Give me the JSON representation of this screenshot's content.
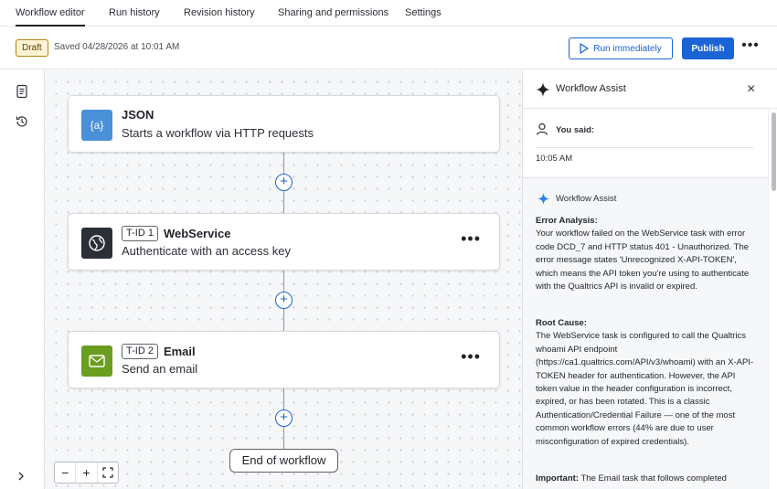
{
  "tabs": [
    {
      "label": "Workflow editor",
      "active": true
    },
    {
      "label": "Run history",
      "active": false
    },
    {
      "label": "Revision history",
      "active": false
    },
    {
      "label": "Sharing and permissions",
      "active": false
    },
    {
      "label": "Settings",
      "active": false
    }
  ],
  "toolbar": {
    "status_badge": "Draft",
    "saved_text": "Saved 04/28/2026 at 10:01 AM",
    "run_label": "Run immediately",
    "publish_label": "Publish",
    "more_label": "•••"
  },
  "leftbar": {
    "icons": [
      "document-icon",
      "history-icon",
      "chevron-right-icon"
    ]
  },
  "canvas": {
    "nodes": [
      {
        "icon": "json-braces-icon",
        "icon_text": "{a}",
        "tid": "",
        "title": "JSON",
        "subtitle": "Starts a workflow via HTTP requests",
        "icon_color": "#4a90d9"
      },
      {
        "icon": "globe-icon",
        "icon_text": "",
        "tid": "T-ID 1",
        "title": "WebService",
        "subtitle": "Authenticate with an access key",
        "icon_color": "#2b2f36"
      },
      {
        "icon": "envelope-icon",
        "icon_text": "",
        "tid": "T-ID 2",
        "title": "Email",
        "subtitle": "Send an email",
        "icon_color": "#6a9e1f"
      }
    ],
    "end_label": "End of workflow",
    "add_step_label": "+",
    "zoom": {
      "out": "−",
      "in": "+",
      "fit": "⛶"
    }
  },
  "panel": {
    "title": "Workflow Assist",
    "close": "×",
    "you_said_label": "You said:",
    "you_said_time": "10:05 AM",
    "assist_label": "Workflow Assist",
    "error_heading": "Error Analysis:",
    "error_text": "Your workflow failed on the WebService task with error code DCD_7 and HTTP status 401 - Unauthorized. The error message states 'Unrecognized X-API-TOKEN', which means the API token you're using to authenticate with the Qualtrics API is invalid or expired.",
    "root_heading": "Root Cause:",
    "root_text": "The WebService task is configured to call the Qualtrics whoami API endpoint (https://ca1.qualtrics.com/API/v3/whoami) with an X-API-TOKEN header for authentication. However, the API token value in the header configuration is incorrect, expired, or has been rotated. This is a classic Authentication/Credential Failure — one of the most common workflow errors (44% are due to user misconfiguration of expired credentials).",
    "important_heading": "Important:",
    "important_text": "The Email task that follows completed"
  },
  "colors": {
    "accent": "#1a64d6",
    "draft_bg": "#fff4d6",
    "canvas_bg": "#f6f7f8"
  }
}
